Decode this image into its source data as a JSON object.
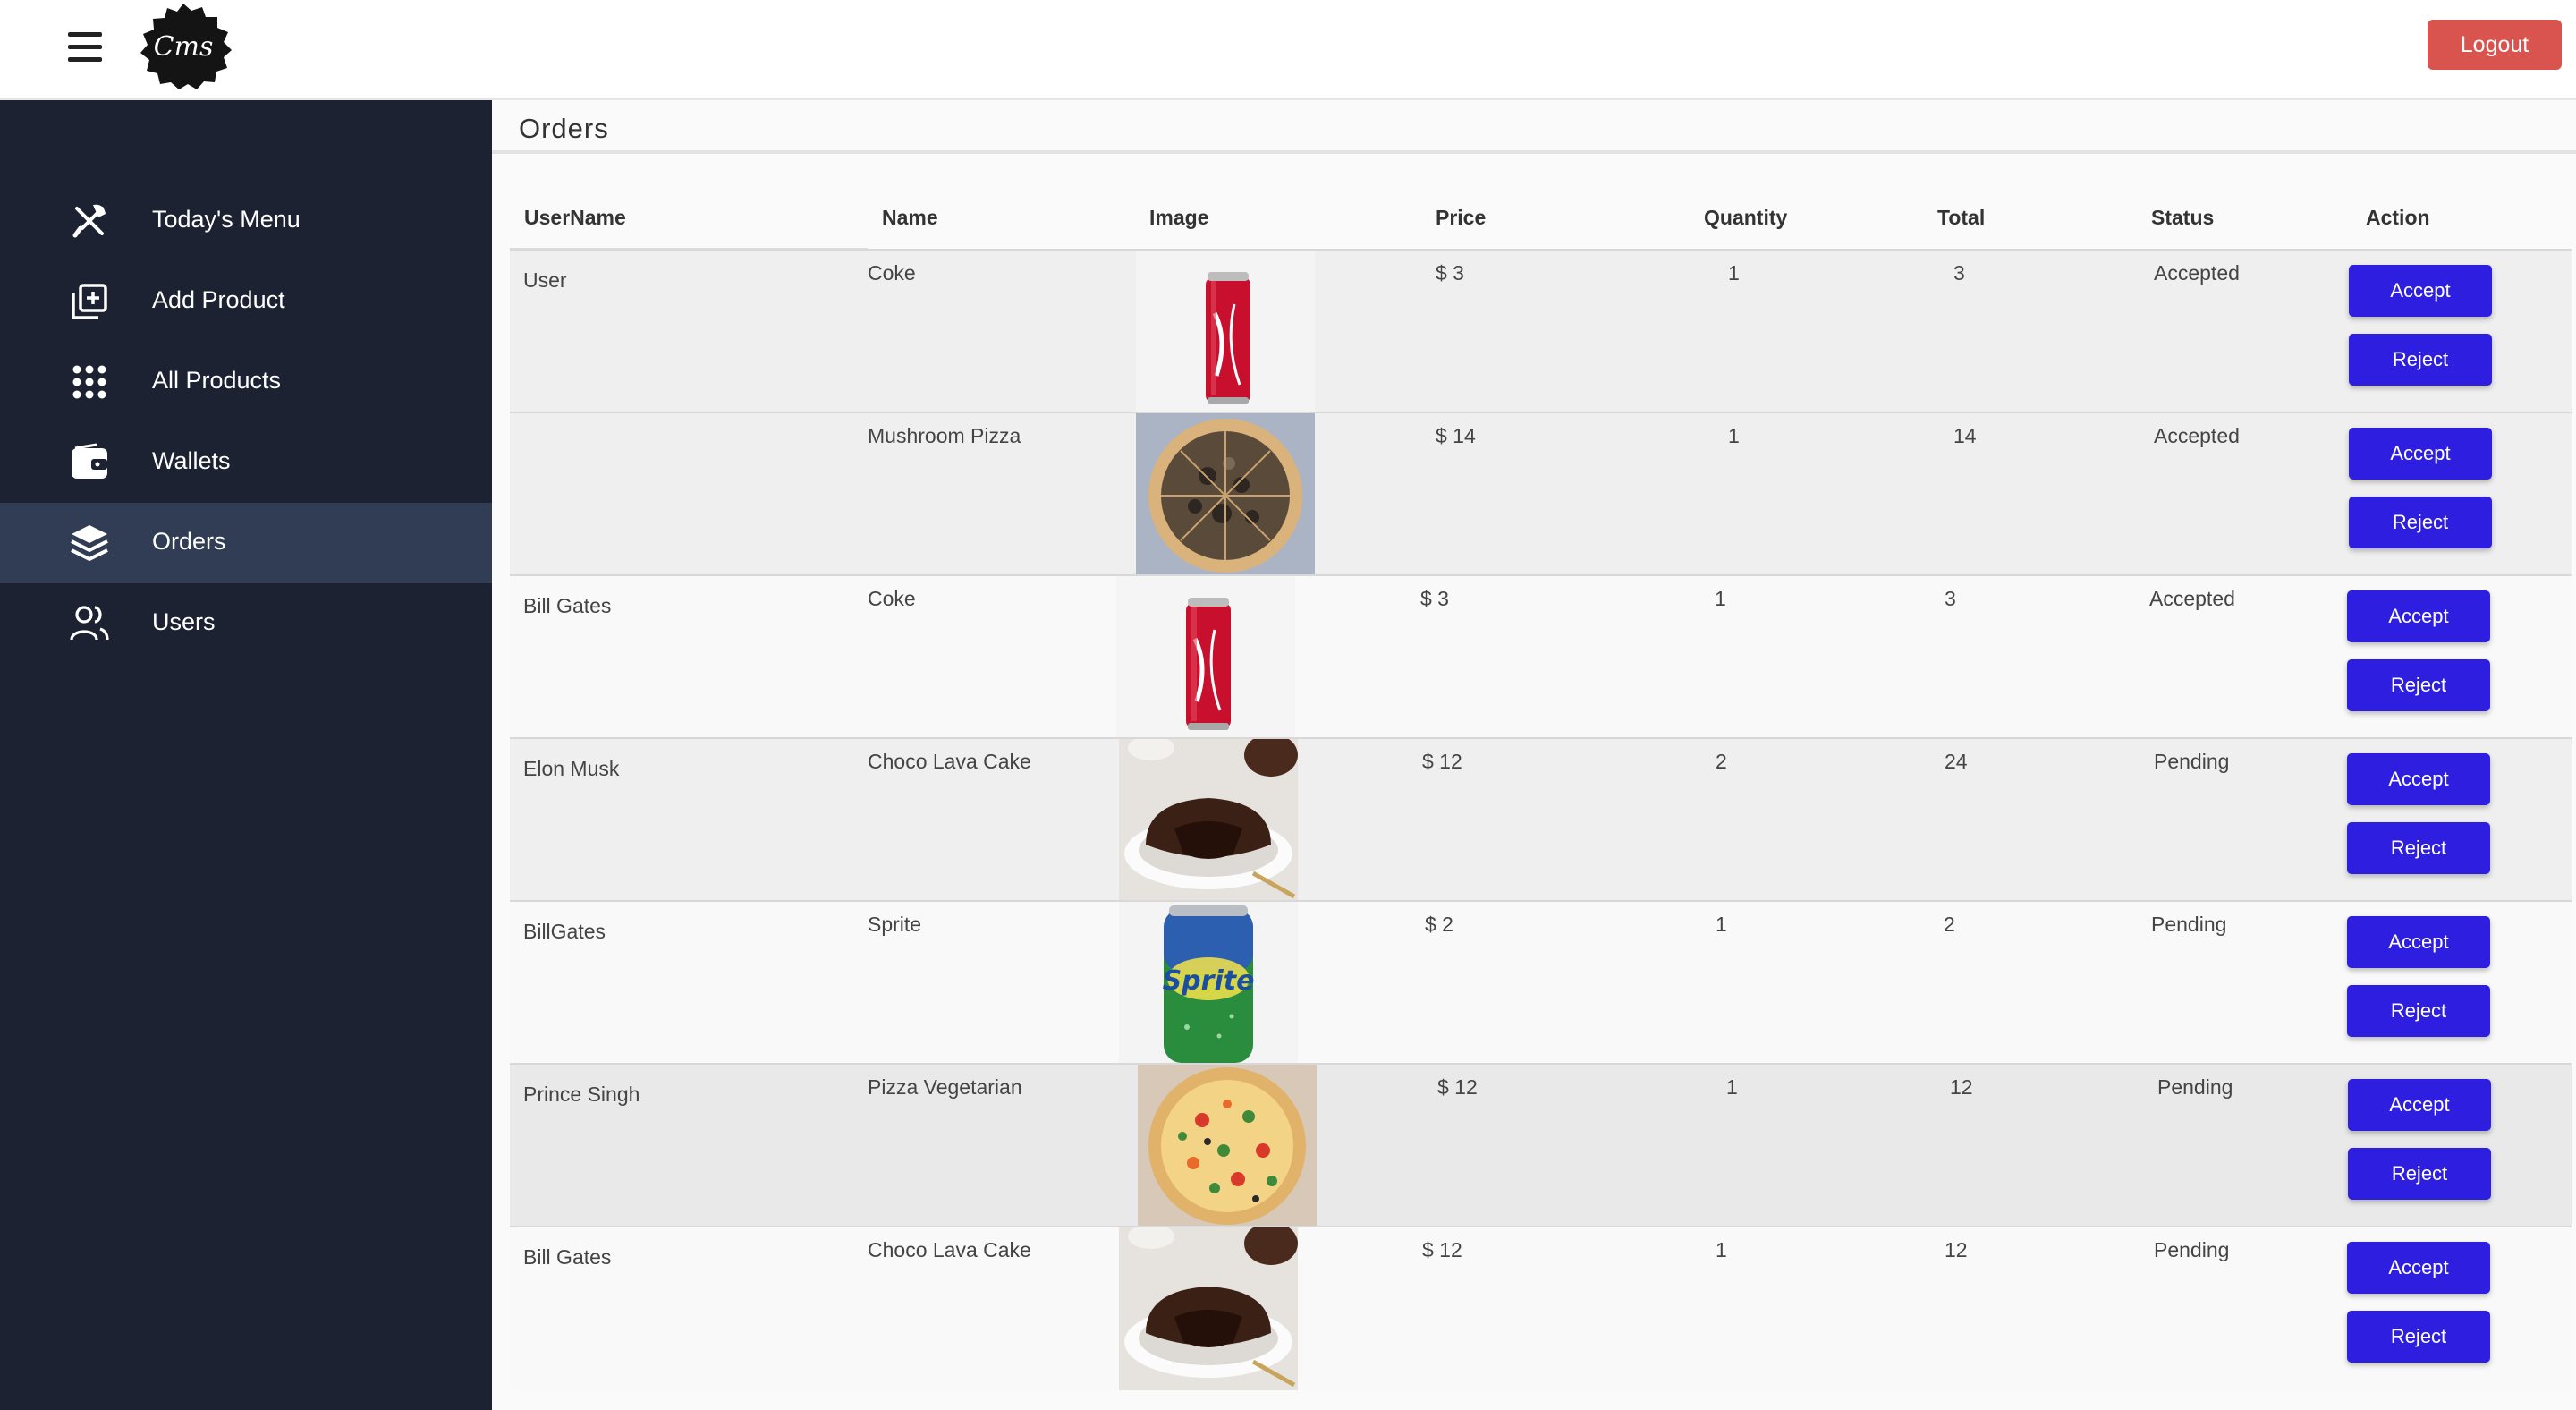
{
  "header": {
    "logo_text": "Cms",
    "logout_label": "Logout"
  },
  "sidebar": {
    "items": [
      {
        "label": "Today's Menu",
        "icon": "utensils-crossed-icon",
        "active": false
      },
      {
        "label": "Add Product",
        "icon": "add-box-icon",
        "active": false
      },
      {
        "label": "All Products",
        "icon": "grid-dots-icon",
        "active": false
      },
      {
        "label": "Wallets",
        "icon": "wallet-icon",
        "active": false
      },
      {
        "label": "Orders",
        "icon": "layers-icon",
        "active": true
      },
      {
        "label": "Users",
        "icon": "users-icon",
        "active": false
      }
    ]
  },
  "main": {
    "title": "Orders",
    "columns": [
      "UserName",
      "Name",
      "Image",
      "Price",
      "Quantity",
      "Total",
      "Status",
      "Action"
    ],
    "accept_label": "Accept",
    "reject_label": "Reject",
    "rows": [
      {
        "user": "User",
        "name": "Coke",
        "image": "coke-can",
        "price": "$ 3",
        "quantity": "1",
        "total": "3",
        "status": "Accepted"
      },
      {
        "user": "",
        "name": "Mushroom Pizza",
        "image": "mushroom-pizza",
        "price": "$ 14",
        "quantity": "1",
        "total": "14",
        "status": "Accepted"
      },
      {
        "user": "Bill Gates",
        "name": "Coke",
        "image": "coke-can",
        "price": "$ 3",
        "quantity": "1",
        "total": "3",
        "status": "Accepted"
      },
      {
        "user": "Elon Musk",
        "name": "Choco Lava Cake",
        "image": "choco-lava-cake",
        "price": "$ 12",
        "quantity": "2",
        "total": "24",
        "status": "Pending"
      },
      {
        "user": "BillGates",
        "name": "Sprite",
        "image": "sprite-can",
        "price": "$ 2",
        "quantity": "1",
        "total": "2",
        "status": "Pending"
      },
      {
        "user": "Prince Singh",
        "name": "Pizza Vegetarian",
        "image": "veg-pizza",
        "price": "$ 12",
        "quantity": "1",
        "total": "12",
        "status": "Pending"
      },
      {
        "user": "Bill Gates",
        "name": "Choco Lava Cake",
        "image": "choco-lava-cake",
        "price": "$ 12",
        "quantity": "1",
        "total": "12",
        "status": "Pending"
      }
    ]
  },
  "colors": {
    "sidebar_bg": "#1c2232",
    "sidebar_active": "#313d54",
    "button": "#2e1ee0",
    "logout": "#d9534f"
  }
}
